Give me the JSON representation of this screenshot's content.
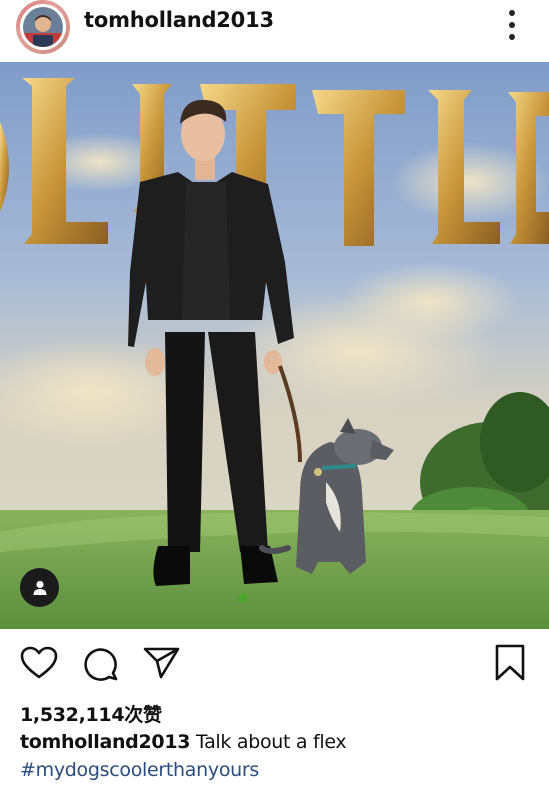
{
  "post": {
    "username": "tomholland2013",
    "likes_text": "1,532,114次赞",
    "caption_user": "tomholland2013",
    "caption_text": "Talk about a flex",
    "hashtag": "#mydogscoolerthanyours"
  },
  "photo": {
    "backdrop_letters": [
      "L",
      "I",
      "T",
      "T",
      "L",
      "E"
    ],
    "backdrop_text": "LITTLE"
  },
  "icons": {
    "more": "more-vertical-icon",
    "like": "heart-icon",
    "comment": "comment-icon",
    "share": "send-icon",
    "save": "bookmark-icon",
    "tags": "user-tag-icon"
  },
  "colors": {
    "hashtag": "#2a4d7d",
    "text": "#111111",
    "sky": "#8fa9cf",
    "grass": "#6fa24e",
    "gold": "#d6ab4c"
  }
}
